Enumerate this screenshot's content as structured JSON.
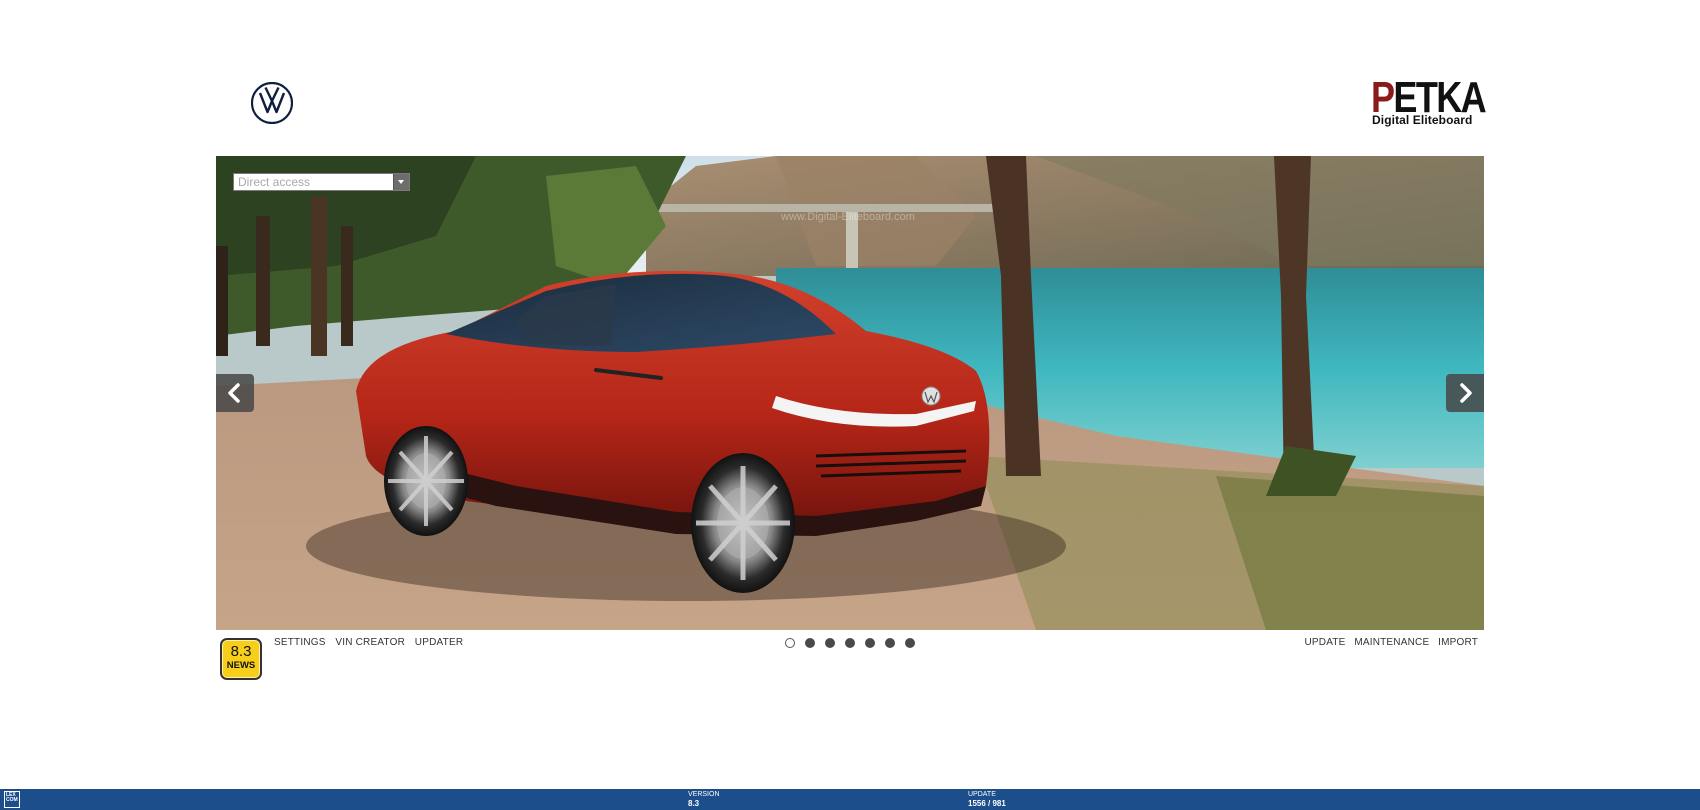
{
  "header": {
    "brand_logo": "vw-logo",
    "app_logo": {
      "title_first": "P",
      "title_rest": "ETKA",
      "subtitle": "Digital Eliteboard"
    }
  },
  "hero": {
    "direct_access": {
      "placeholder": "Direct access",
      "value": ""
    },
    "watermark": "www.Digital-Eliteboard.com",
    "prev_icon": "chevron-left-icon",
    "next_icon": "chevron-right-icon",
    "slides": {
      "total": 7,
      "active_index": 0
    }
  },
  "news_badge": {
    "version": "8.3",
    "label": "NEWS"
  },
  "menu_left": {
    "settings": "SETTINGS",
    "vin_creator": "VIN CREATOR",
    "updater": "UPDATER"
  },
  "menu_right": {
    "update": "UPDATE",
    "maintenance": "MAINTENANCE",
    "import": "IMPORT"
  },
  "status_bar": {
    "logo_text": "LEX COM",
    "version_label": "VERSION",
    "version_value": "8.3",
    "update_label": "UPDATE",
    "update_value": "1556 / 981"
  },
  "colors": {
    "status_bar": "#1c4e8c",
    "petka_accent": "#8b1a1a",
    "badge": "#f7cf1b",
    "car_red": "#b8261a"
  }
}
